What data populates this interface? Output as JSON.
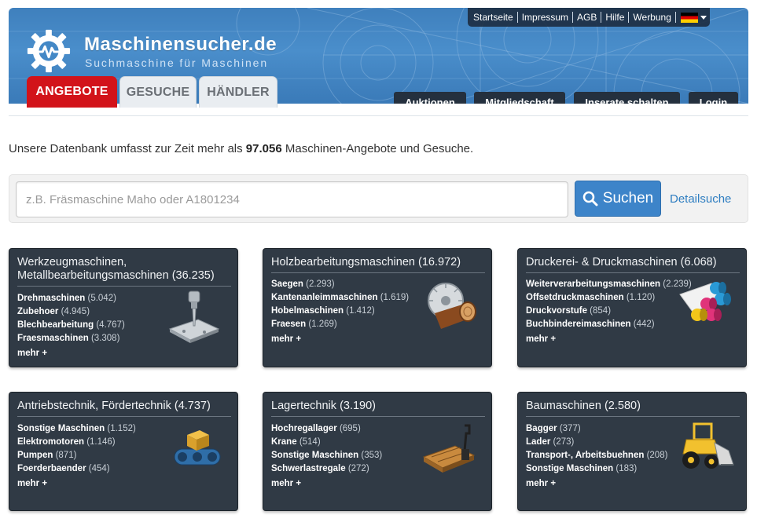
{
  "brand": {
    "title": "Maschinensucher.de",
    "subtitle": "Suchmaschine für Maschinen"
  },
  "topnav": [
    "Startseite",
    "Impressum",
    "AGB",
    "Hilfe",
    "Werbung"
  ],
  "tabs": {
    "angebote": "ANGEBOTE",
    "gesuche": "GESUCHE",
    "haendler": "HÄNDLER"
  },
  "header_buttons": {
    "auktionen": "Auktionen",
    "mitgliedschaft": "Mitgliedschaft",
    "inserate": "Inserate schalten",
    "login": "Login"
  },
  "colors": {
    "header_blue": "#4a8ecb",
    "active_tab": "#d2131a",
    "card_bg": "#303a45",
    "bar_auktionen": "#c9a227",
    "bar_mitgliedschaft": "#c0392b",
    "bar_inserate": "#3fc6c9",
    "bar_login": "#8bbf3c",
    "search_button": "#3d84c9"
  },
  "intro": {
    "before": "Unsere Datenbank umfasst zur Zeit mehr als ",
    "count": "97.056",
    "after": " Maschinen-Angebote und Gesuche."
  },
  "search": {
    "placeholder": "z.B. Fräsmaschine Maho oder A1801234",
    "button_label": "Suchen",
    "detail_link": "Detailsuche"
  },
  "categories": [
    {
      "title_line1": "Werkzeugmaschinen,",
      "title_line2": "Metallbearbeitungsmaschinen",
      "count": "(36.235)",
      "icon": "drill-press-icon",
      "items": [
        {
          "name": "Drehmaschinen",
          "count": "(5.042)"
        },
        {
          "name": "Zubehoer",
          "count": "(4.945)"
        },
        {
          "name": "Blechbearbeitung",
          "count": "(4.767)"
        },
        {
          "name": "Fraesmaschinen",
          "count": "(3.308)"
        }
      ],
      "more": "mehr +"
    },
    {
      "title_line1": "Holzbearbeitungsmaschinen",
      "count": "(16.972)",
      "icon": "saw-log-icon",
      "items": [
        {
          "name": "Saegen",
          "count": "(2.293)"
        },
        {
          "name": "Kantenanleimmaschinen",
          "count": "(1.619)"
        },
        {
          "name": "Hobelmaschinen",
          "count": "(1.412)"
        },
        {
          "name": "Fraesen",
          "count": "(1.269)"
        }
      ],
      "more": "mehr +"
    },
    {
      "title_line1": "Druckerei- & Druckmaschinen",
      "count": "(6.068)",
      "icon": "print-rollers-icon",
      "items": [
        {
          "name": "Weiterverarbeitungsmaschinen",
          "count": "(2.239)"
        },
        {
          "name": "Offsetdruckmaschinen",
          "count": "(1.120)"
        },
        {
          "name": "Druckvorstufe",
          "count": "(854)"
        },
        {
          "name": "Buchbindereimaschinen",
          "count": "(442)"
        }
      ],
      "more": "mehr +"
    },
    {
      "title_line1": "Antriebstechnik, Fördertechnik",
      "count": "(4.737)",
      "icon": "conveyor-icon",
      "items": [
        {
          "name": "Sonstige Maschinen",
          "count": "(1.152)"
        },
        {
          "name": "Elektromotoren",
          "count": "(1.146)"
        },
        {
          "name": "Pumpen",
          "count": "(871)"
        },
        {
          "name": "Foerderbaender",
          "count": "(454)"
        }
      ],
      "more": "mehr +"
    },
    {
      "title_line1": "Lagertechnik",
      "count": "(3.190)",
      "icon": "pallet-jack-icon",
      "items": [
        {
          "name": "Hochregallager",
          "count": "(695)"
        },
        {
          "name": "Krane",
          "count": "(514)"
        },
        {
          "name": "Sonstige Maschinen",
          "count": "(353)"
        },
        {
          "name": "Schwerlastregale",
          "count": "(272)"
        }
      ],
      "more": "mehr +"
    },
    {
      "title_line1": "Baumaschinen",
      "count": "(2.580)",
      "icon": "wheel-loader-icon",
      "items": [
        {
          "name": "Bagger",
          "count": "(377)"
        },
        {
          "name": "Lader",
          "count": "(273)"
        },
        {
          "name": "Transport-, Arbeitsbuehnen",
          "count": "(208)"
        },
        {
          "name": "Sonstige Maschinen",
          "count": "(183)"
        }
      ],
      "more": "mehr +"
    }
  ]
}
